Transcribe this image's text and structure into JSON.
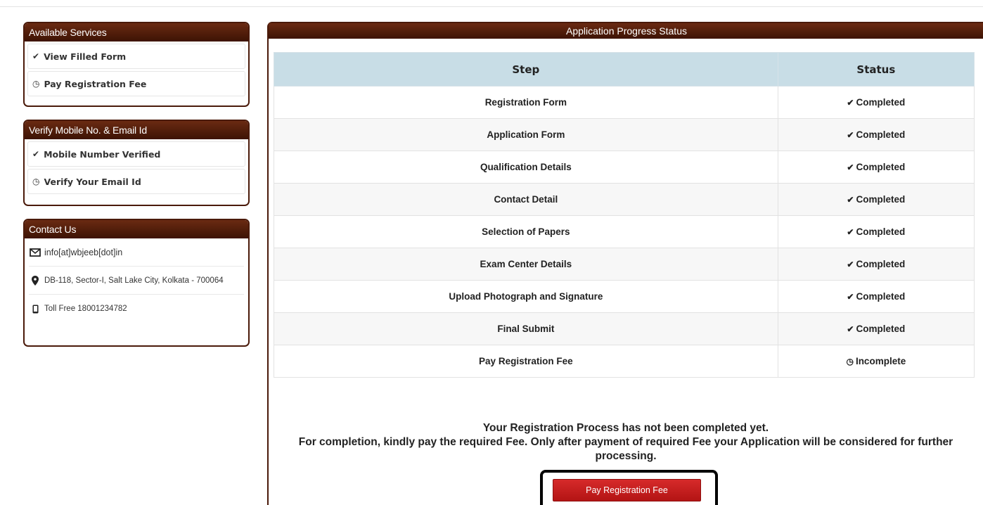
{
  "sidebar": {
    "services": {
      "title": "Available Services",
      "items": [
        {
          "icon": "check-circle",
          "label": "View Filled Form"
        },
        {
          "icon": "clock-circle",
          "label": "Pay Registration Fee"
        }
      ]
    },
    "verify": {
      "title": "Verify Mobile No. & Email Id",
      "items": [
        {
          "icon": "check-circle",
          "label": "Mobile Number Verified"
        },
        {
          "icon": "clock-circle",
          "label": "Verify Your Email Id"
        }
      ]
    },
    "contact": {
      "title": "Contact Us",
      "email": "info[at]wbjeeb[dot]in",
      "address": "DB-118, Sector-I, Salt Lake City, Kolkata - 700064",
      "phone": "Toll Free 18001234782"
    }
  },
  "main": {
    "title": "Application Progress Status",
    "columns": [
      "Step",
      "Status"
    ],
    "rows": [
      {
        "step": "Registration Form",
        "status": "Completed",
        "state": "done"
      },
      {
        "step": "Application Form",
        "status": "Completed",
        "state": "done"
      },
      {
        "step": "Qualification Details",
        "status": "Completed",
        "state": "done"
      },
      {
        "step": "Contact Detail",
        "status": "Completed",
        "state": "done"
      },
      {
        "step": "Selection of Papers",
        "status": "Completed",
        "state": "done"
      },
      {
        "step": "Exam Center Details",
        "status": "Completed",
        "state": "done"
      },
      {
        "step": "Upload Photograph and Signature",
        "status": "Completed",
        "state": "done"
      },
      {
        "step": "Final Submit",
        "status": "Completed",
        "state": "done"
      },
      {
        "step": "Pay Registration Fee",
        "status": "Incomplete",
        "state": "pending"
      }
    ],
    "notice_line1": "Your Registration Process has not been completed yet.",
    "notice_line2": "For completion, kindly pay the required Fee. Only after payment of required Fee your Application will be considered for further processing.",
    "pay_button": "Pay Registration Fee"
  },
  "colors": {
    "panel_header": "#4a1a0a",
    "table_header": "#c8dde6",
    "completed": "#226622",
    "incomplete": "#cc1111",
    "pay_button": "#c81e1e"
  }
}
